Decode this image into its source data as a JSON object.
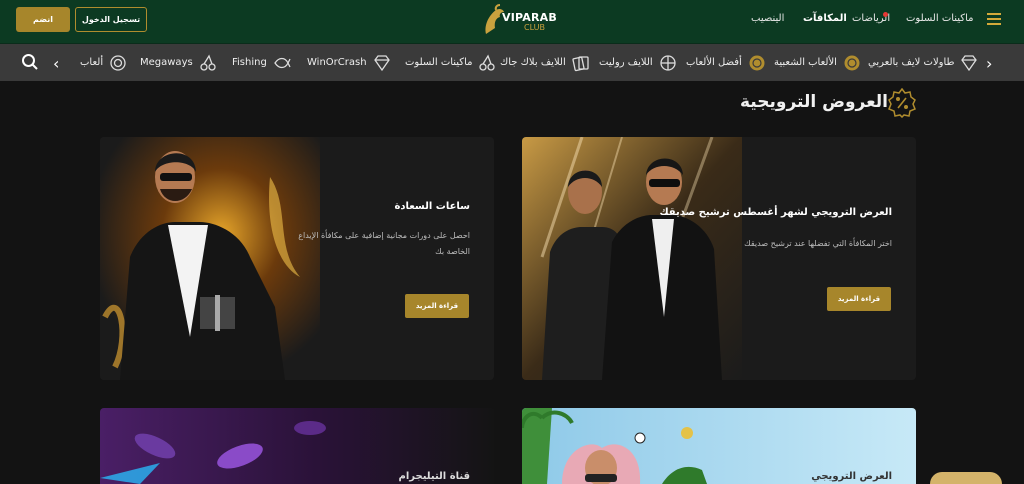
{
  "header": {
    "join_label": "انضم",
    "login_label": "تسجيل الدخول",
    "logo_text": "VIPARAB",
    "logo_sub": "CLUB",
    "nav": [
      "الينصيب",
      "المكافآت",
      "الرياضات",
      "ماكينات السلوت"
    ]
  },
  "categories": [
    {
      "label": "ألعاب",
      "icon": "roulette-icon"
    },
    {
      "label": "Megaways",
      "icon": "cherries-icon"
    },
    {
      "label": "Fishing",
      "icon": "fish-icon"
    },
    {
      "label": "WinOrCrash",
      "icon": "diamond-icon"
    },
    {
      "label": "ماكينات السلوت",
      "icon": "cherries-icon"
    },
    {
      "label": "اللايف بلاك جاك",
      "icon": "cards-icon"
    },
    {
      "label": "اللايف روليت",
      "icon": "roulette-icon"
    },
    {
      "label": "أفضل الألعاب",
      "icon": "coin-icon"
    },
    {
      "label": "الألعاب الشعبية",
      "icon": "coin-icon"
    },
    {
      "label": "طاولات لايف بالعربي",
      "icon": "diamond-icon"
    }
  ],
  "page": {
    "title": "العروض الترويجية"
  },
  "promos": [
    {
      "title": "ساعات السعادة",
      "desc_line1": "احصل على دورات مجانية إضافية على مكافأة الإيداع",
      "desc_line2": "الخاصة بك",
      "button": "قراءة المزيد"
    },
    {
      "title": "العرض الترويجي لشهر أغسطس ترشيح صديقك",
      "desc_line1": "اختر المكافأة التي تفضلها عند ترشيح صديقك",
      "button": "قراءة المزيد"
    },
    {
      "title": "قناة التيليجرام"
    },
    {
      "title": "العرض الترويجي"
    }
  ],
  "colors": {
    "header_bg": "#0c3a22",
    "gold": "#a7862b",
    "catbar_bg": "#3a3a3a",
    "page_bg": "#131313"
  }
}
